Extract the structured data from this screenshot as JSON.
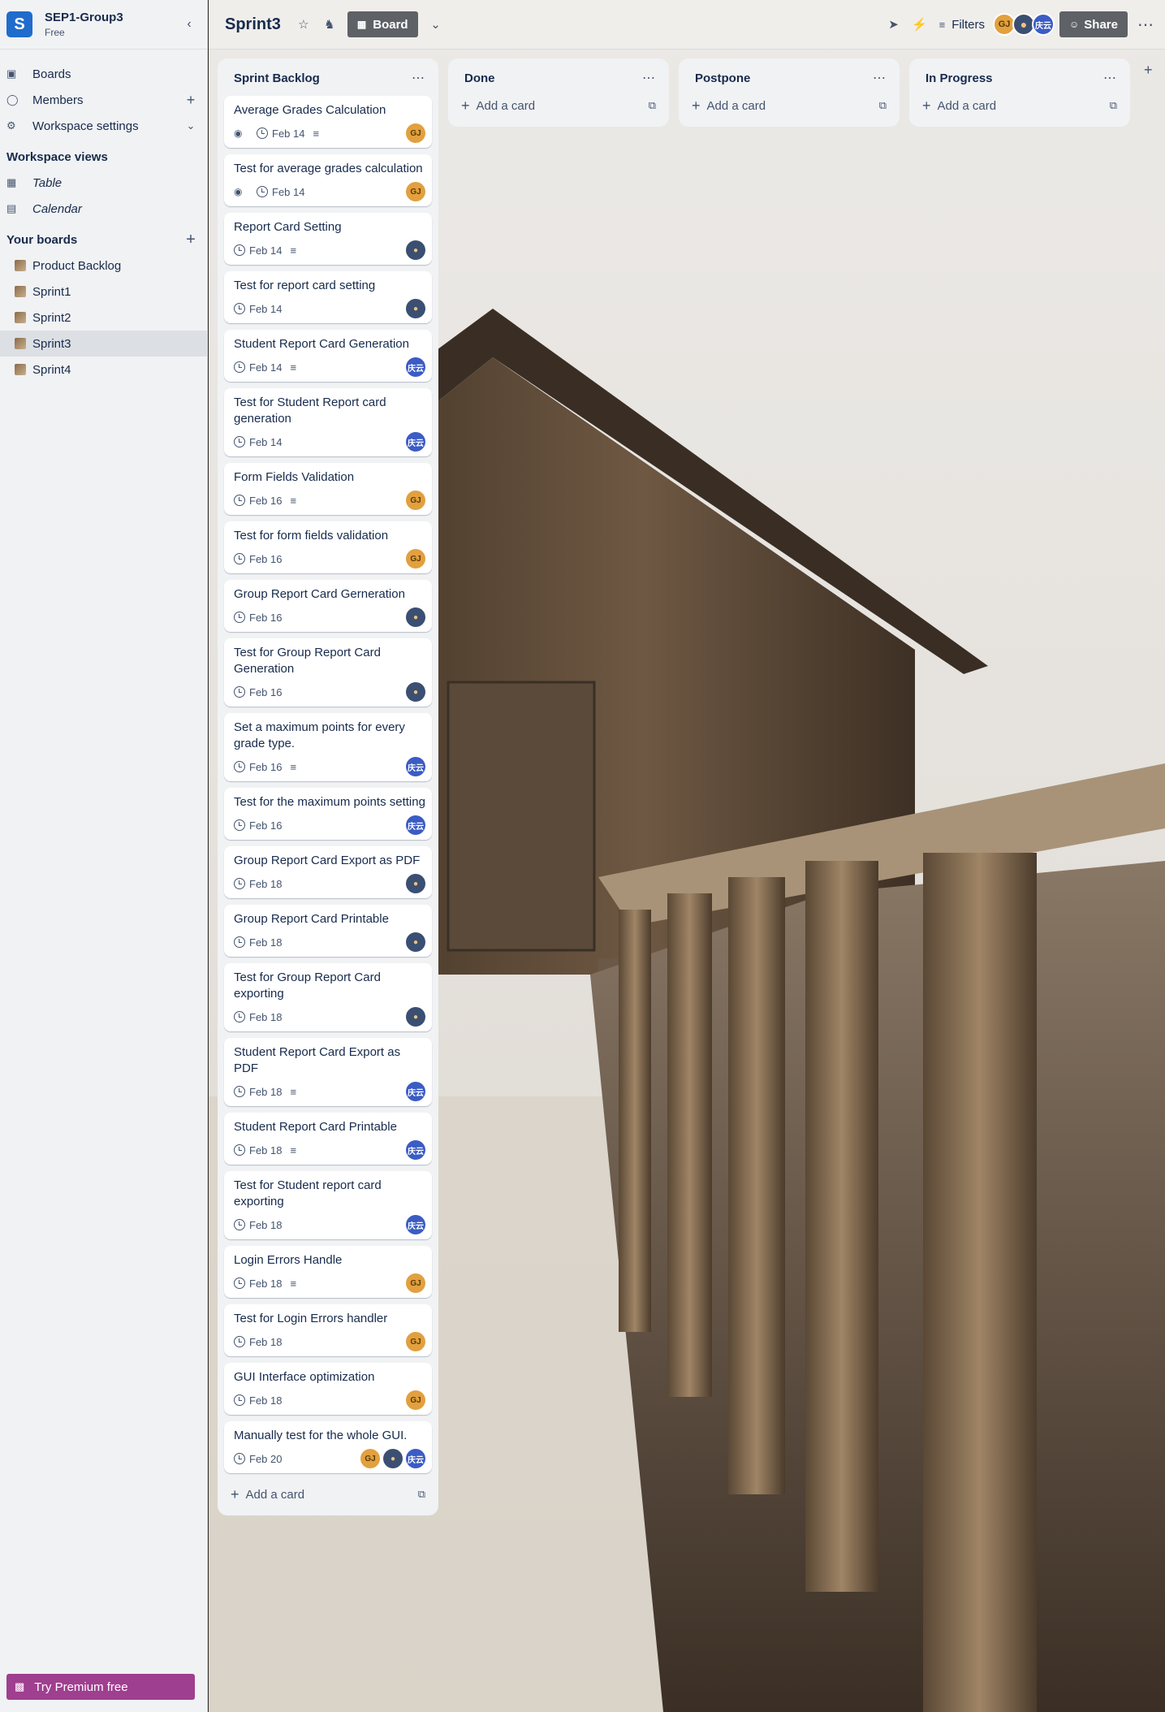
{
  "workspace": {
    "initial": "S",
    "name": "SEP1-Group3",
    "plan": "Free"
  },
  "sidebar": {
    "nav": [
      {
        "label": "Boards",
        "icon": "boards-icon"
      },
      {
        "label": "Members",
        "icon": "members-icon"
      },
      {
        "label": "Workspace settings",
        "icon": "gear-icon"
      }
    ],
    "views_title": "Workspace views",
    "views": [
      {
        "label": "Table",
        "icon": "table-icon"
      },
      {
        "label": "Calendar",
        "icon": "calendar-icon"
      }
    ],
    "boards_title": "Your boards",
    "boards": [
      "Product Backlog",
      "Sprint1",
      "Sprint2",
      "Sprint3",
      "Sprint4"
    ],
    "premium_label": "Try Premium free"
  },
  "topbar": {
    "title": "Sprint3",
    "board_view_label": "Board",
    "filters_label": "Filters",
    "share_label": "Share",
    "members": [
      "GJ",
      "person",
      "庆云"
    ]
  },
  "lists": [
    {
      "title": "Sprint Backlog",
      "cards": [
        {
          "title": "Average Grades Calculation",
          "watch": true,
          "date": "Feb 14",
          "desc": true,
          "members": [
            "GJ"
          ]
        },
        {
          "title": "Test for average grades calculation",
          "watch": true,
          "date": "Feb 14",
          "desc": false,
          "members": [
            "GJ"
          ]
        },
        {
          "title": "Report Card Setting",
          "watch": false,
          "date": "Feb 14",
          "desc": true,
          "members": [
            "person"
          ]
        },
        {
          "title": "Test for report card setting",
          "watch": false,
          "date": "Feb 14",
          "desc": false,
          "members": [
            "person"
          ]
        },
        {
          "title": "Student Report Card Generation",
          "watch": false,
          "date": "Feb 14",
          "desc": true,
          "members": [
            "庆云"
          ]
        },
        {
          "title": "Test for Student Report card generation",
          "watch": false,
          "date": "Feb 14",
          "desc": false,
          "members": [
            "庆云"
          ]
        },
        {
          "title": "Form Fields Validation",
          "watch": false,
          "date": "Feb 16",
          "desc": true,
          "members": [
            "GJ"
          ]
        },
        {
          "title": "Test for form fields validation",
          "watch": false,
          "date": "Feb 16",
          "desc": false,
          "members": [
            "GJ"
          ]
        },
        {
          "title": "Group Report Card Gerneration",
          "watch": false,
          "date": "Feb 16",
          "desc": false,
          "members": [
            "person"
          ]
        },
        {
          "title": "Test for Group Report Card Generation",
          "watch": false,
          "date": "Feb 16",
          "desc": false,
          "members": [
            "person"
          ]
        },
        {
          "title": "Set a maximum points for every grade type.",
          "watch": false,
          "date": "Feb 16",
          "desc": true,
          "members": [
            "庆云"
          ]
        },
        {
          "title": "Test for the maximum points setting",
          "watch": false,
          "date": "Feb 16",
          "desc": false,
          "members": [
            "庆云"
          ]
        },
        {
          "title": "Group Report Card Export as PDF",
          "watch": false,
          "date": "Feb 18",
          "desc": false,
          "members": [
            "person"
          ]
        },
        {
          "title": "Group Report Card Printable",
          "watch": false,
          "date": "Feb 18",
          "desc": false,
          "members": [
            "person"
          ]
        },
        {
          "title": "Test for Group Report Card exporting",
          "watch": false,
          "date": "Feb 18",
          "desc": false,
          "members": [
            "person"
          ]
        },
        {
          "title": "Student Report Card Export as PDF",
          "watch": false,
          "date": "Feb 18",
          "desc": true,
          "members": [
            "庆云"
          ]
        },
        {
          "title": "Student Report Card Printable",
          "watch": false,
          "date": "Feb 18",
          "desc": true,
          "members": [
            "庆云"
          ]
        },
        {
          "title": "Test for Student report card exporting",
          "watch": false,
          "date": "Feb 18",
          "desc": false,
          "members": [
            "庆云"
          ]
        },
        {
          "title": "Login Errors Handle",
          "watch": false,
          "date": "Feb 18",
          "desc": true,
          "members": [
            "GJ"
          ]
        },
        {
          "title": "Test for Login Errors handler",
          "watch": false,
          "date": "Feb 18",
          "desc": false,
          "members": [
            "GJ"
          ]
        },
        {
          "title": "GUI Interface optimization",
          "watch": false,
          "date": "Feb 18",
          "desc": false,
          "members": [
            "GJ"
          ]
        },
        {
          "title": "Manually test for the whole GUI.",
          "watch": false,
          "date": "Feb 20",
          "desc": false,
          "members": [
            "GJ",
            "person",
            "庆云"
          ]
        }
      ],
      "add_label": "Add a card"
    },
    {
      "title": "Done",
      "cards": [],
      "add_label": "Add a card"
    },
    {
      "title": "Postpone",
      "cards": [],
      "add_label": "Add a card"
    },
    {
      "title": "In Progress",
      "cards": [],
      "add_label": "Add a card"
    }
  ],
  "colors": {
    "premium": "#9f3f8f",
    "logo": "#1f6ccc",
    "list_bg": "#f1f2f4"
  }
}
